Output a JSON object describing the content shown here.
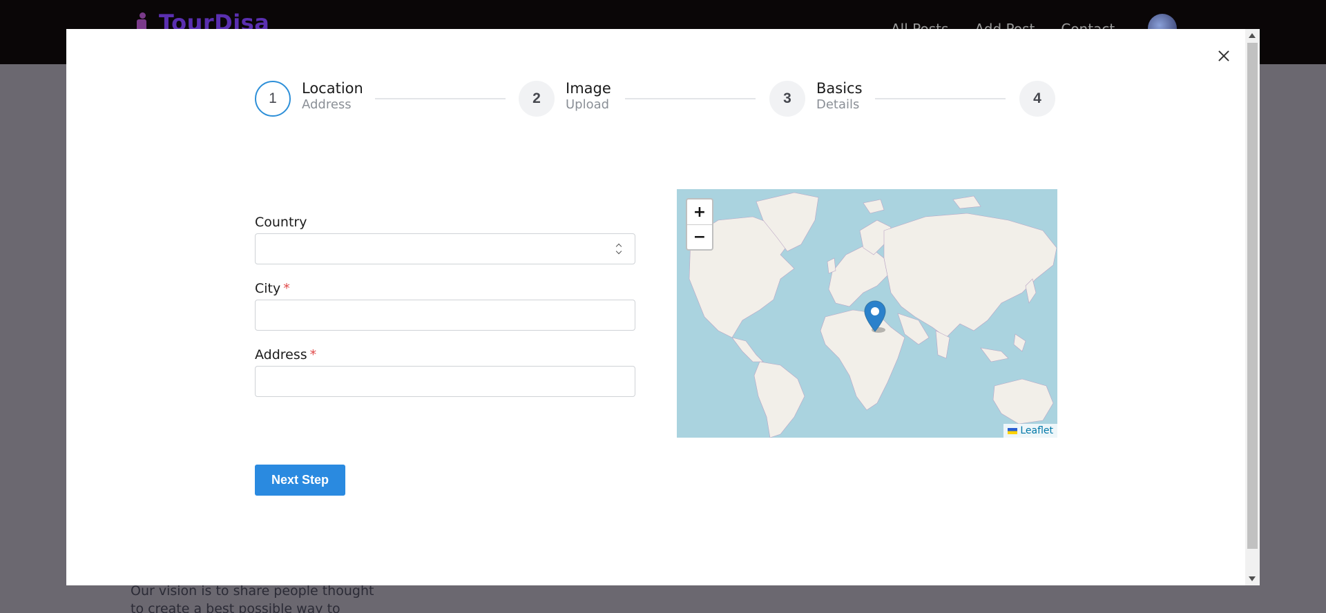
{
  "background": {
    "brand": "TourDisa",
    "nav": [
      "All Posts",
      "Add Post",
      "Contact"
    ],
    "text": "Our vision is to share people thought to create a best possible way to share"
  },
  "steps": [
    {
      "number": "1",
      "title": "Location",
      "subtitle": "Address",
      "active": true
    },
    {
      "number": "2",
      "title": "Image",
      "subtitle": "Upload",
      "active": false
    },
    {
      "number": "3",
      "title": "Basics",
      "subtitle": "Details",
      "active": false
    },
    {
      "number": "4",
      "title": "",
      "subtitle": "",
      "active": false
    }
  ],
  "form": {
    "country_label": "Country",
    "country_value": "",
    "city_label": "City",
    "city_value": "",
    "address_label": "Address",
    "address_value": "",
    "required_mark": "*",
    "next_label": "Next Step"
  },
  "map": {
    "zoom_in": "+",
    "zoom_out": "−",
    "attribution": "Leaflet",
    "marker_color": "#2a81cb"
  },
  "colors": {
    "accent": "#2a8ae0",
    "required": "#e04848"
  }
}
